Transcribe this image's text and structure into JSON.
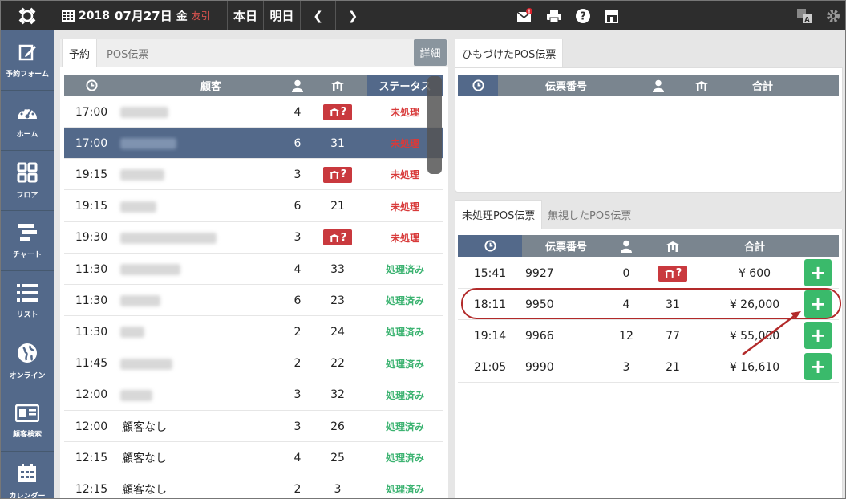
{
  "top": {
    "year": "2018",
    "md": "07月27日",
    "wd": "金",
    "rokuyo": "友引",
    "today": "本日",
    "tomorrow": "明日",
    "prev": "❮",
    "next": "❯"
  },
  "sidebar": [
    {
      "label": "予約フォーム",
      "icon": "edit-icon"
    },
    {
      "label": "ホーム",
      "icon": "dashboard-icon"
    },
    {
      "label": "フロア",
      "icon": "grid-icon"
    },
    {
      "label": "チャート",
      "icon": "chart-icon"
    },
    {
      "label": "リスト",
      "icon": "list-icon"
    },
    {
      "label": "オンライン",
      "icon": "globe-icon"
    },
    {
      "label": "顧客検索",
      "icon": "id-card-icon"
    },
    {
      "label": "カレンダー",
      "icon": "calendar-icon"
    }
  ],
  "left": {
    "tabs": [
      "予約",
      "POS伝票"
    ],
    "detail": "詳細",
    "headers": {
      "customer": "顧客",
      "status": "ステータス"
    },
    "rows": [
      {
        "time": "17:00",
        "name": "",
        "n": "4",
        "table": "?",
        "status": "未処理",
        "st": "red"
      },
      {
        "time": "17:00",
        "name": "",
        "n": "6",
        "table": "31",
        "status": "未処理",
        "st": "red",
        "selected": true
      },
      {
        "time": "19:15",
        "name": "",
        "n": "3",
        "table": "?",
        "status": "未処理",
        "st": "red"
      },
      {
        "time": "19:15",
        "name": "",
        "n": "6",
        "table": "21",
        "status": "未処理",
        "st": "red"
      },
      {
        "time": "19:30",
        "name": "",
        "n": "3",
        "table": "?",
        "status": "未処理",
        "st": "red"
      },
      {
        "time": "11:30",
        "name": "",
        "n": "4",
        "table": "33",
        "status": "処理済み",
        "st": "green"
      },
      {
        "time": "11:30",
        "name": "",
        "n": "6",
        "table": "23",
        "status": "処理済み",
        "st": "green"
      },
      {
        "time": "11:30",
        "name": "",
        "n": "2",
        "table": "24",
        "status": "処理済み",
        "st": "green"
      },
      {
        "time": "11:45",
        "name": "",
        "n": "2",
        "table": "22",
        "status": "処理済み",
        "st": "green"
      },
      {
        "time": "12:00",
        "name": "",
        "n": "3",
        "table": "32",
        "status": "処理済み",
        "st": "green"
      },
      {
        "time": "12:00",
        "name": "顧客なし",
        "n": "3",
        "table": "26",
        "status": "処理済み",
        "st": "green"
      },
      {
        "time": "12:15",
        "name": "顧客なし",
        "n": "4",
        "table": "25",
        "status": "処理済み",
        "st": "green"
      },
      {
        "time": "12:15",
        "name": "顧客なし",
        "n": "2",
        "table": "3",
        "status": "処理済み",
        "st": "green"
      }
    ]
  },
  "linked": {
    "tab": "ひもづけたPOS伝票",
    "headers": {
      "slip": "伝票番号",
      "total": "合計"
    }
  },
  "unproc": {
    "tabs": [
      "未処理POS伝票",
      "無視したPOS伝票"
    ],
    "headers": {
      "slip": "伝票番号",
      "total": "合計"
    },
    "rows": [
      {
        "time": "15:41",
        "slip": "9927",
        "n": "0",
        "table": "?",
        "total": "¥ 600"
      },
      {
        "time": "18:11",
        "slip": "9950",
        "n": "4",
        "table": "31",
        "total": "¥ 26,000"
      },
      {
        "time": "19:14",
        "slip": "9966",
        "n": "12",
        "table": "77",
        "total": "¥ 55,000"
      },
      {
        "time": "21:05",
        "slip": "9990",
        "n": "3",
        "table": "21",
        "total": "¥ 16,610"
      }
    ]
  },
  "colors": {
    "accent": "#53698a",
    "red": "#d83a3a",
    "green": "#3cb371",
    "plus": "#3aba6b",
    "annotation": "#b22a2a"
  }
}
